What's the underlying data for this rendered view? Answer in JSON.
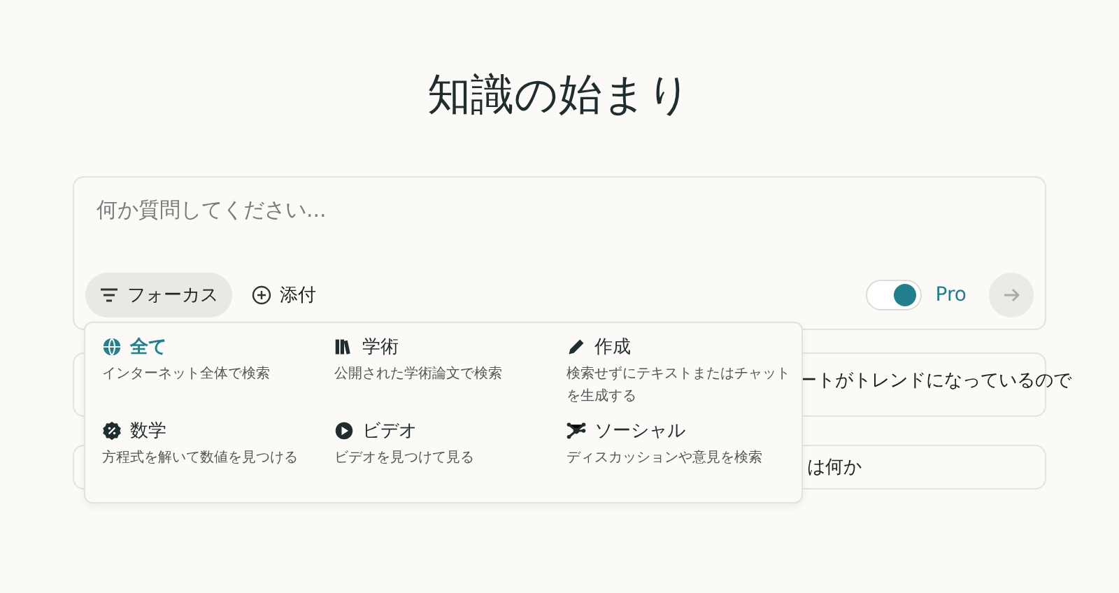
{
  "title": "知識の始まり",
  "search": {
    "placeholder": "何か質問してください...",
    "focus_button": "フォーカス",
    "attach_button": "添付",
    "pro": {
      "label": "Pro",
      "on": true
    }
  },
  "suggestions": [
    {
      "text": "ートがトレンドになっているので"
    },
    {
      "text": "は何か"
    }
  ],
  "focus_menu": [
    {
      "kind": "globe",
      "label": "全て",
      "description": "インターネット全体で検索",
      "selected": true
    },
    {
      "kind": "books",
      "label": "学術",
      "description": "公開された学術論文で検索",
      "selected": false
    },
    {
      "kind": "pencil",
      "label": "作成",
      "description": "検索せずにテキストまたはチャットを生成する",
      "selected": false
    },
    {
      "kind": "percent",
      "label": "数学",
      "description": "方程式を解いて数値を見つける",
      "selected": false
    },
    {
      "kind": "play",
      "label": "ビデオ",
      "description": "ビデオを見つけて見る",
      "selected": false
    },
    {
      "kind": "network",
      "label": "ソーシャル",
      "description": "ディスカッションや意見を検索",
      "selected": false
    }
  ]
}
